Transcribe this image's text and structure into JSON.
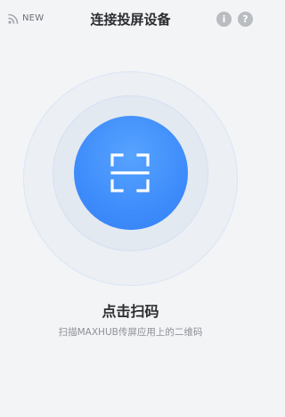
{
  "header": {
    "new_label": "NEW",
    "title": "连接投屏设备",
    "info_glyph": "i",
    "help_glyph": "?"
  },
  "main": {
    "action_title": "点击扫码",
    "action_description": "扫描MAXHUB传屏应用上的二维码"
  },
  "icons": {
    "wifi": "wifi-signal-icon",
    "info": "info-icon",
    "help": "help-icon",
    "scan": "scan-frame-icon"
  },
  "colors": {
    "accent": "#3e8cfb",
    "background": "#f3f4f6",
    "icon_gray": "#b9bcc1"
  }
}
